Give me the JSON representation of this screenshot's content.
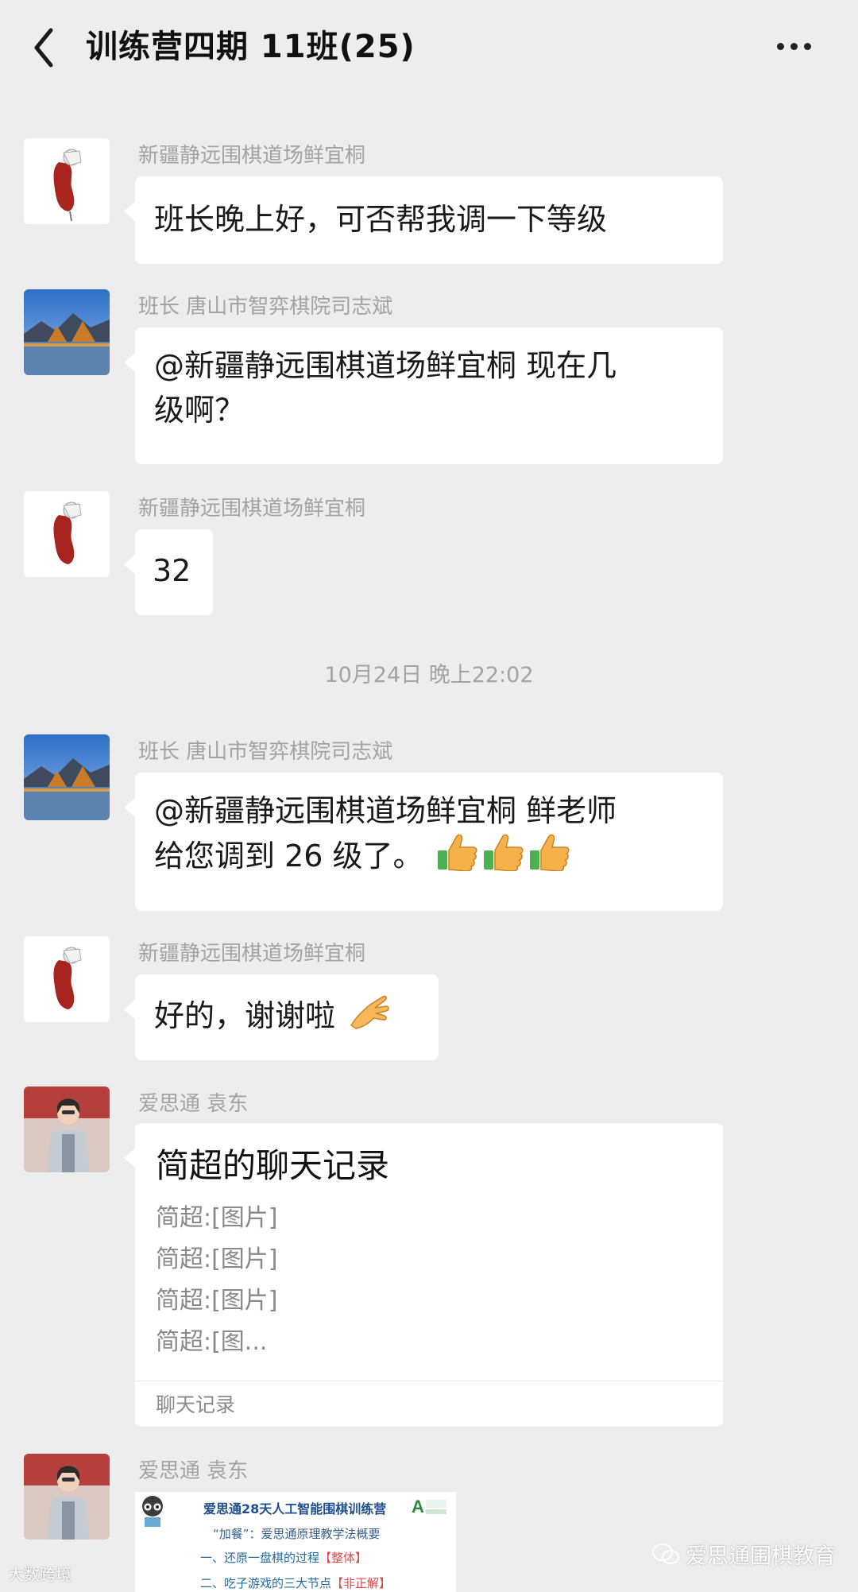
{
  "header": {
    "title": "训练营四期 11班(25)"
  },
  "messages": [
    {
      "sender": "新疆静远围棋道场鲜宜桐",
      "text": "班长晚上好，可否帮我调一下等级"
    },
    {
      "sender": "班长 唐山市智弈棋院司志斌",
      "line1": "@新疆静远围棋道场鲜宜桐  现在几",
      "line2": "级啊？"
    },
    {
      "sender": "新疆静远围棋道场鲜宜桐",
      "text": "32"
    },
    {
      "sender": "班长 唐山市智弈棋院司志斌",
      "line1": "@新疆静远围棋道场鲜宜桐  鲜老师",
      "line2": "给您调到 26 级了。"
    },
    {
      "sender": "新疆静远围棋道场鲜宜桐",
      "text": "好的，谢谢啦"
    },
    {
      "sender": "爱思通 袁东"
    },
    {
      "sender": "爱思通 袁东"
    }
  ],
  "timestamp": "10月24日 晚上22:02",
  "chat_record_card": {
    "title": "简超的聊天记录",
    "lines": [
      "简超:[图片]",
      "简超:[图片]",
      "简超:[图片]",
      "简超:[图..."
    ],
    "footer": "聊天记录"
  },
  "image_message": {
    "title": "爱思通28天人工智能围棋训练营",
    "subtitle": "“加餐”：爱思通原理教学法概要",
    "item1_text": "一、还原一盘棋的过程",
    "item1_tag": "【整体】",
    "item2_text": "二、吃子游戏的三大节点",
    "item2_tag": "【非正解】"
  },
  "watermarks": {
    "right": "爱思通围棋教育",
    "left": "大数跨境"
  },
  "colors": {
    "background": "#ededed",
    "bubble": "#ffffff",
    "meta_text": "#a3a3a3"
  },
  "icons": [
    "back-arrow-icon",
    "more-dots-icon",
    "thumbs-up-emoji",
    "hand-emoji"
  ]
}
